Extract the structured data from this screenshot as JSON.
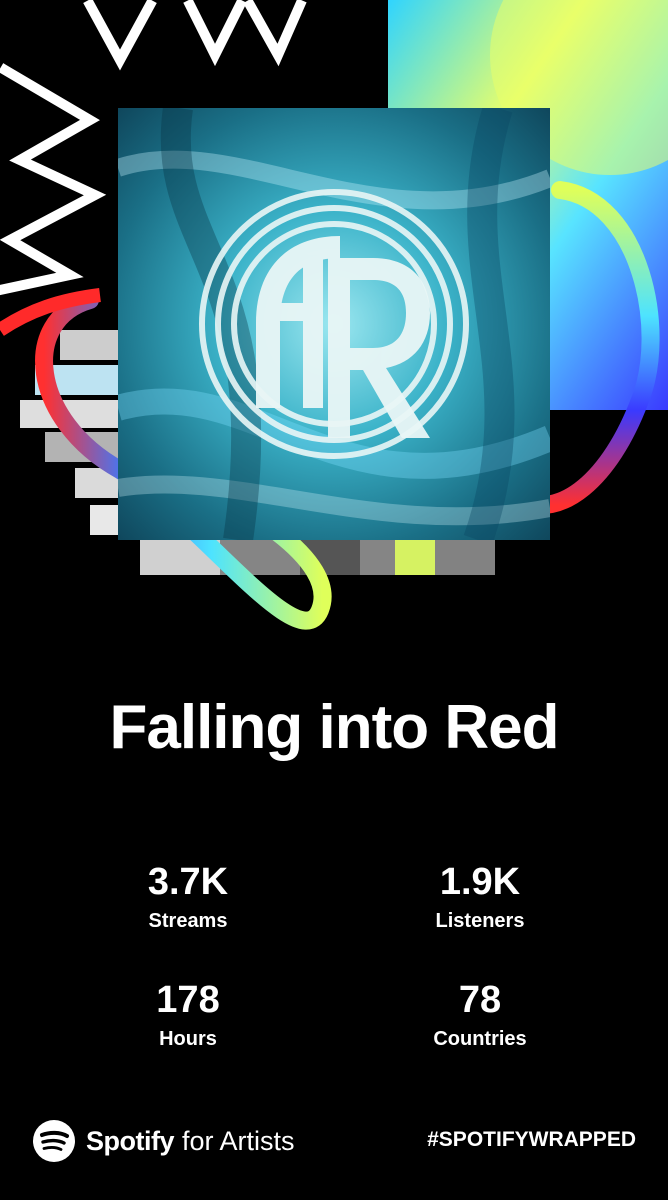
{
  "artist": {
    "name": "Falling into Red"
  },
  "stats": [
    {
      "value": "3.7K",
      "label": "Streams"
    },
    {
      "value": "1.9K",
      "label": "Listeners"
    },
    {
      "value": "178",
      "label": "Hours"
    },
    {
      "value": "78",
      "label": "Countries"
    }
  ],
  "footer": {
    "brand": "Spotify",
    "brand_suffix": "for Artists",
    "hashtag": "#SPOTIFYWRAPPED"
  },
  "colors": {
    "background": "#000000",
    "text": "#ffffff",
    "accent_yellow": "#d9ff60",
    "accent_cyan": "#3ad3ff",
    "accent_blue": "#3b3bff",
    "accent_red": "#ff2a2a"
  },
  "icons": {
    "logo": "spotify-logo-icon",
    "cover_logo": "fir-monogram-icon"
  }
}
